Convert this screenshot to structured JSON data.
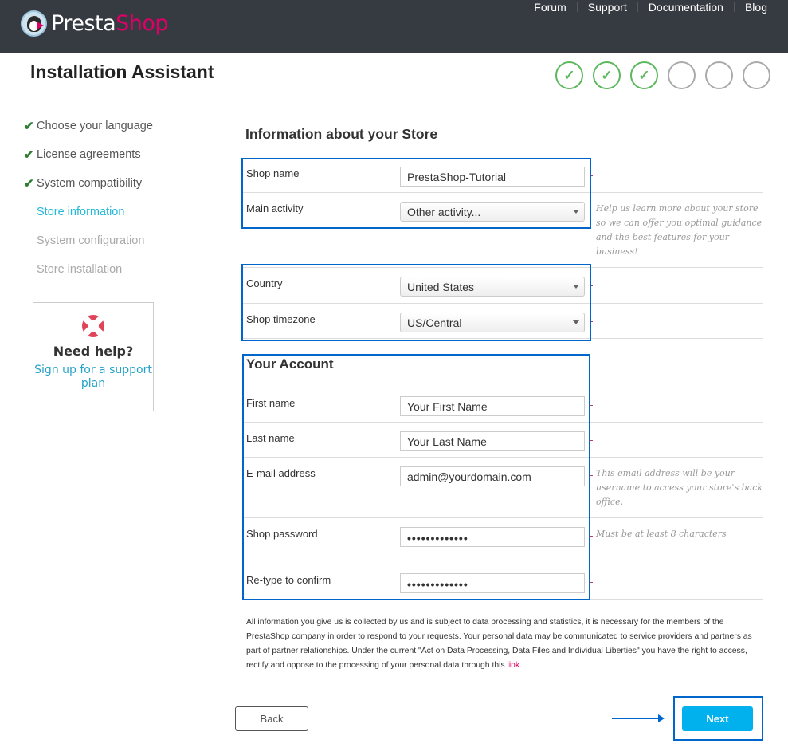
{
  "header": {
    "logo_part1": "Presta",
    "logo_part2": "Shop",
    "nav": [
      "Forum",
      "Support",
      "Documentation",
      "Blog"
    ]
  },
  "page_title": "Installation Assistant",
  "progress": {
    "total_steps": 6,
    "completed_steps": 3,
    "check_glyph": "✓"
  },
  "sidebar": {
    "items": [
      {
        "label": "Choose your language",
        "state": "done"
      },
      {
        "label": "License agreements",
        "state": "done"
      },
      {
        "label": "System compatibility",
        "state": "done"
      },
      {
        "label": "Store information",
        "state": "current"
      },
      {
        "label": "System configuration",
        "state": "todo"
      },
      {
        "label": "Store installation",
        "state": "todo"
      }
    ],
    "check_glyph": "✔"
  },
  "help": {
    "icon": "lifebuoy-icon",
    "title": "Need help?",
    "link": "Sign up for a support plan"
  },
  "store_section": {
    "title": "Information about your Store",
    "shop_name_label": "Shop name",
    "shop_name_value": "PrestaShop-Tutorial",
    "activity_label": "Main activity",
    "activity_value": "Other activity...",
    "activity_hint": "Help us learn more about your store so we can offer you optimal guidance and the best features for your business!",
    "country_label": "Country",
    "country_value": "United States",
    "timezone_label": "Shop timezone",
    "timezone_value": "US/Central"
  },
  "account_section": {
    "title": "Your Account",
    "first_name_label": "First name",
    "first_name_value": "Your First Name",
    "last_name_label": "Last name",
    "last_name_value": "Your Last Name",
    "email_label": "E-mail address",
    "email_value": "admin@yourdomain.com",
    "email_hint": "This email address will be your username to access your store's back office.",
    "password_label": "Shop password",
    "password_value": "•••••••••••••",
    "password_hint": "Must be at least 8 characters",
    "confirm_label": "Re-type to confirm",
    "confirm_value": "•••••••••••••"
  },
  "disclaimer": {
    "text": "All information you give us is collected by us and is subject to data processing and statistics, it is necessary for the members of the PrestaShop company in order to respond to your requests. Your personal data may be communicated to service providers and partners as part of partner relationships. Under the current \"Act on Data Processing, Data Files and Individual Liberties\" you have the right to access, rectify and oppose to the processing of your personal data through this ",
    "link": "link",
    "end": "."
  },
  "buttons": {
    "back": "Back",
    "next": "Next"
  },
  "colors": {
    "topbar": "#363a41",
    "brand_pink": "#df0067",
    "accent_blue": "#25b9d7",
    "next_button": "#00b1ed",
    "done_green": "#5cb85c",
    "highlight": "#0066cc"
  }
}
